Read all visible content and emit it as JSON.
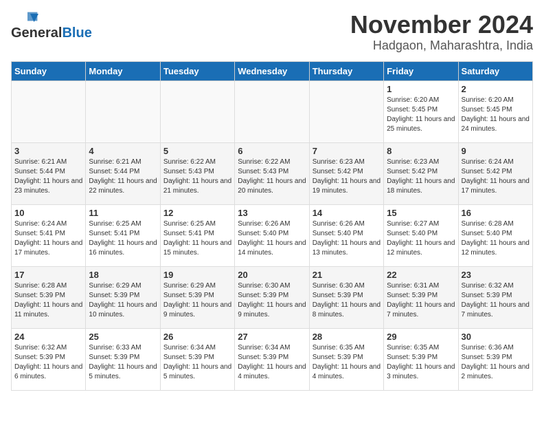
{
  "header": {
    "logo_general": "General",
    "logo_blue": "Blue",
    "month_title": "November 2024",
    "location": "Hadgaon, Maharashtra, India"
  },
  "days_of_week": [
    "Sunday",
    "Monday",
    "Tuesday",
    "Wednesday",
    "Thursday",
    "Friday",
    "Saturday"
  ],
  "weeks": [
    [
      {
        "day": "",
        "empty": true
      },
      {
        "day": "",
        "empty": true
      },
      {
        "day": "",
        "empty": true
      },
      {
        "day": "",
        "empty": true
      },
      {
        "day": "",
        "empty": true
      },
      {
        "day": "1",
        "sunrise": "6:20 AM",
        "sunset": "5:45 PM",
        "daylight": "11 hours and 25 minutes."
      },
      {
        "day": "2",
        "sunrise": "6:20 AM",
        "sunset": "5:45 PM",
        "daylight": "11 hours and 24 minutes."
      }
    ],
    [
      {
        "day": "3",
        "sunrise": "6:21 AM",
        "sunset": "5:44 PM",
        "daylight": "11 hours and 23 minutes."
      },
      {
        "day": "4",
        "sunrise": "6:21 AM",
        "sunset": "5:44 PM",
        "daylight": "11 hours and 22 minutes."
      },
      {
        "day": "5",
        "sunrise": "6:22 AM",
        "sunset": "5:43 PM",
        "daylight": "11 hours and 21 minutes."
      },
      {
        "day": "6",
        "sunrise": "6:22 AM",
        "sunset": "5:43 PM",
        "daylight": "11 hours and 20 minutes."
      },
      {
        "day": "7",
        "sunrise": "6:23 AM",
        "sunset": "5:42 PM",
        "daylight": "11 hours and 19 minutes."
      },
      {
        "day": "8",
        "sunrise": "6:23 AM",
        "sunset": "5:42 PM",
        "daylight": "11 hours and 18 minutes."
      },
      {
        "day": "9",
        "sunrise": "6:24 AM",
        "sunset": "5:42 PM",
        "daylight": "11 hours and 17 minutes."
      }
    ],
    [
      {
        "day": "10",
        "sunrise": "6:24 AM",
        "sunset": "5:41 PM",
        "daylight": "11 hours and 17 minutes."
      },
      {
        "day": "11",
        "sunrise": "6:25 AM",
        "sunset": "5:41 PM",
        "daylight": "11 hours and 16 minutes."
      },
      {
        "day": "12",
        "sunrise": "6:25 AM",
        "sunset": "5:41 PM",
        "daylight": "11 hours and 15 minutes."
      },
      {
        "day": "13",
        "sunrise": "6:26 AM",
        "sunset": "5:40 PM",
        "daylight": "11 hours and 14 minutes."
      },
      {
        "day": "14",
        "sunrise": "6:26 AM",
        "sunset": "5:40 PM",
        "daylight": "11 hours and 13 minutes."
      },
      {
        "day": "15",
        "sunrise": "6:27 AM",
        "sunset": "5:40 PM",
        "daylight": "11 hours and 12 minutes."
      },
      {
        "day": "16",
        "sunrise": "6:28 AM",
        "sunset": "5:40 PM",
        "daylight": "11 hours and 12 minutes."
      }
    ],
    [
      {
        "day": "17",
        "sunrise": "6:28 AM",
        "sunset": "5:39 PM",
        "daylight": "11 hours and 11 minutes."
      },
      {
        "day": "18",
        "sunrise": "6:29 AM",
        "sunset": "5:39 PM",
        "daylight": "11 hours and 10 minutes."
      },
      {
        "day": "19",
        "sunrise": "6:29 AM",
        "sunset": "5:39 PM",
        "daylight": "11 hours and 9 minutes."
      },
      {
        "day": "20",
        "sunrise": "6:30 AM",
        "sunset": "5:39 PM",
        "daylight": "11 hours and 9 minutes."
      },
      {
        "day": "21",
        "sunrise": "6:30 AM",
        "sunset": "5:39 PM",
        "daylight": "11 hours and 8 minutes."
      },
      {
        "day": "22",
        "sunrise": "6:31 AM",
        "sunset": "5:39 PM",
        "daylight": "11 hours and 7 minutes."
      },
      {
        "day": "23",
        "sunrise": "6:32 AM",
        "sunset": "5:39 PM",
        "daylight": "11 hours and 7 minutes."
      }
    ],
    [
      {
        "day": "24",
        "sunrise": "6:32 AM",
        "sunset": "5:39 PM",
        "daylight": "11 hours and 6 minutes."
      },
      {
        "day": "25",
        "sunrise": "6:33 AM",
        "sunset": "5:39 PM",
        "daylight": "11 hours and 5 minutes."
      },
      {
        "day": "26",
        "sunrise": "6:34 AM",
        "sunset": "5:39 PM",
        "daylight": "11 hours and 5 minutes."
      },
      {
        "day": "27",
        "sunrise": "6:34 AM",
        "sunset": "5:39 PM",
        "daylight": "11 hours and 4 minutes."
      },
      {
        "day": "28",
        "sunrise": "6:35 AM",
        "sunset": "5:39 PM",
        "daylight": "11 hours and 4 minutes."
      },
      {
        "day": "29",
        "sunrise": "6:35 AM",
        "sunset": "5:39 PM",
        "daylight": "11 hours and 3 minutes."
      },
      {
        "day": "30",
        "sunrise": "6:36 AM",
        "sunset": "5:39 PM",
        "daylight": "11 hours and 2 minutes."
      }
    ]
  ]
}
